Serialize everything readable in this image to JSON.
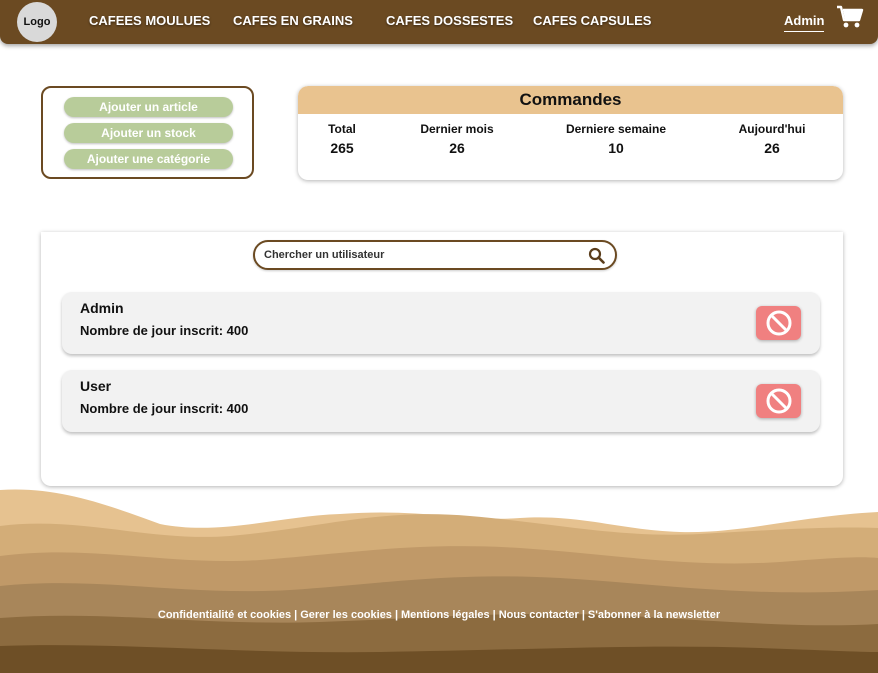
{
  "navbar": {
    "logo": "Logo",
    "links": [
      "CAFEES MOULUES",
      "CAFES EN GRAINS",
      "CAFES DOSSESTES",
      "CAFES CAPSULES"
    ],
    "admin": "Admin",
    "cart_icon": "shopping-cart-icon"
  },
  "actions": {
    "add_article": "Ajouter un article",
    "add_stock": "Ajouter un stock",
    "add_category": "Ajouter une catégorie"
  },
  "orders": {
    "title": "Commandes",
    "stats": [
      {
        "label": "Total",
        "value": "265"
      },
      {
        "label": "Dernier mois",
        "value": "26"
      },
      {
        "label": "Derniere semaine",
        "value": "10"
      },
      {
        "label": "Aujourd'hui",
        "value": "26"
      }
    ]
  },
  "users": {
    "search_placeholder": "Chercher un utilisateur",
    "search_icon": "search-icon",
    "list": [
      {
        "name": "Admin",
        "days": "Nombre de jour inscrit: 400"
      },
      {
        "name": "User",
        "days": "Nombre de jour inscrit: 400"
      }
    ],
    "ban_icon": "ban-icon"
  },
  "footer": {
    "links": [
      "Confidentialité et cookies",
      "Gerer les cookies",
      "Mentions légales",
      "Nous contacter",
      "S'abonner à la newsletter"
    ],
    "separator": "|"
  },
  "colors": {
    "brown": "#6b4a22",
    "sand": "#e9c38f",
    "green": "#b8cc9a",
    "red": "#f08080"
  }
}
